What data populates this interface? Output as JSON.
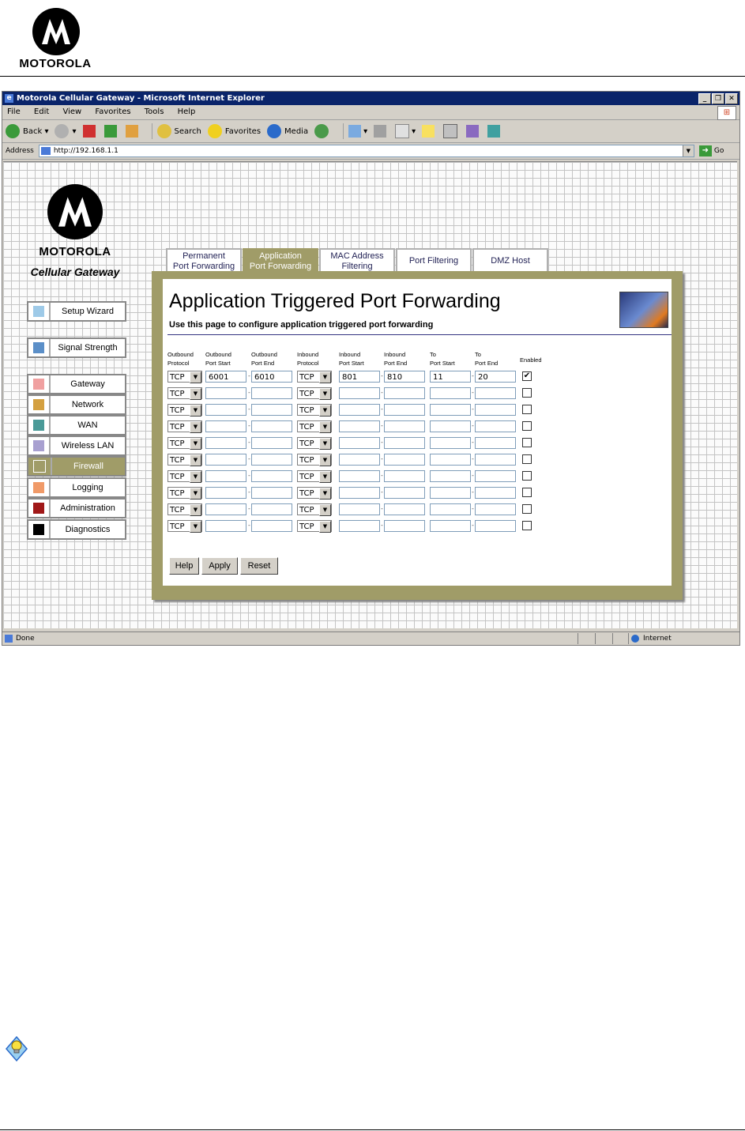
{
  "doc": {
    "brand": "MOTOROLA"
  },
  "browser": {
    "title": "Motorola Cellular Gateway - Microsoft Internet Explorer",
    "menu": [
      "File",
      "Edit",
      "View",
      "Favorites",
      "Tools",
      "Help"
    ],
    "toolbar": {
      "back": "Back",
      "search": "Search",
      "favorites": "Favorites",
      "media": "Media"
    },
    "address_label": "Address",
    "address_value": "http://192.168.1.1",
    "go": "Go",
    "status": "Done",
    "zone": "Internet"
  },
  "sidebar": {
    "brand": "MOTOROLA",
    "product": "Cellular Gateway",
    "items": [
      {
        "label": "Setup Wizard",
        "color": "#9ecae8"
      },
      {
        "label": "Signal Strength",
        "color": "#5b8fc8"
      },
      {
        "label": "Gateway",
        "color": "#f0a0a0"
      },
      {
        "label": "Network",
        "color": "#d4a040"
      },
      {
        "label": "WAN",
        "color": "#4a9a98"
      },
      {
        "label": "Wireless LAN",
        "color": "#a8a0d0"
      },
      {
        "label": "Firewall",
        "color": "#a09c68"
      },
      {
        "label": "Logging",
        "color": "#f09a68"
      },
      {
        "label": "Administration",
        "color": "#a01818"
      },
      {
        "label": "Diagnostics",
        "color": "#000000"
      }
    ],
    "active": "Firewall"
  },
  "tabs": [
    {
      "label": "Permanent\nPort Forwarding"
    },
    {
      "label": "Application\nPort Forwarding",
      "active": true
    },
    {
      "label": "MAC Address\nFiltering"
    },
    {
      "label": "Port Filtering"
    },
    {
      "label": "DMZ Host"
    }
  ],
  "page": {
    "title": "Application Triggered Port Forwarding",
    "subtitle": "Use this page to configure application triggered port forwarding"
  },
  "columns": [
    "Outbound\nProtocol",
    "Outbound\nPort Start",
    "Outbound\nPort End",
    "Inbound\nProtocol",
    "Inbound\nPort Start",
    "Inbound\nPort End",
    "To\nPort Start",
    "To\nPort End",
    "Enabled"
  ],
  "rows": [
    {
      "out_proto": "TCP",
      "out_start": "6001",
      "out_end": "6010",
      "in_proto": "TCP",
      "in_start": "801",
      "in_end": "810",
      "to_start": "11",
      "to_end": "20",
      "enabled": true
    },
    {
      "out_proto": "TCP",
      "out_start": "",
      "out_end": "",
      "in_proto": "TCP",
      "in_start": "",
      "in_end": "",
      "to_start": "",
      "to_end": "",
      "enabled": false
    },
    {
      "out_proto": "TCP",
      "out_start": "",
      "out_end": "",
      "in_proto": "TCP",
      "in_start": "",
      "in_end": "",
      "to_start": "",
      "to_end": "",
      "enabled": false
    },
    {
      "out_proto": "TCP",
      "out_start": "",
      "out_end": "",
      "in_proto": "TCP",
      "in_start": "",
      "in_end": "",
      "to_start": "",
      "to_end": "",
      "enabled": false
    },
    {
      "out_proto": "TCP",
      "out_start": "",
      "out_end": "",
      "in_proto": "TCP",
      "in_start": "",
      "in_end": "",
      "to_start": "",
      "to_end": "",
      "enabled": false
    },
    {
      "out_proto": "TCP",
      "out_start": "",
      "out_end": "",
      "in_proto": "TCP",
      "in_start": "",
      "in_end": "",
      "to_start": "",
      "to_end": "",
      "enabled": false
    },
    {
      "out_proto": "TCP",
      "out_start": "",
      "out_end": "",
      "in_proto": "TCP",
      "in_start": "",
      "in_end": "",
      "to_start": "",
      "to_end": "",
      "enabled": false
    },
    {
      "out_proto": "TCP",
      "out_start": "",
      "out_end": "",
      "in_proto": "TCP",
      "in_start": "",
      "in_end": "",
      "to_start": "",
      "to_end": "",
      "enabled": false
    },
    {
      "out_proto": "TCP",
      "out_start": "",
      "out_end": "",
      "in_proto": "TCP",
      "in_start": "",
      "in_end": "",
      "to_start": "",
      "to_end": "",
      "enabled": false
    },
    {
      "out_proto": "TCP",
      "out_start": "",
      "out_end": "",
      "in_proto": "TCP",
      "in_start": "",
      "in_end": "",
      "to_start": "",
      "to_end": "",
      "enabled": false
    }
  ],
  "buttons": {
    "help": "Help",
    "apply": "Apply",
    "reset": "Reset"
  }
}
